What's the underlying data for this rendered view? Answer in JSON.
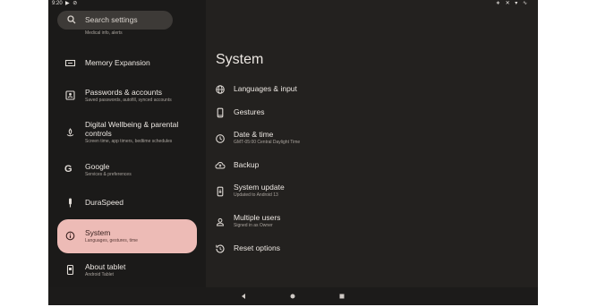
{
  "status_bar": {
    "time": "9:20",
    "left_icons": "▶ ⊘",
    "right_icons": "∗ ✕ ▾ ∿"
  },
  "search": {
    "label": "Search settings"
  },
  "sidebar": {
    "clipped_subtitle": "Medical info, alerts",
    "items": [
      {
        "title": "Memory Expansion",
        "subtitle": "",
        "icon": "memory-icon"
      },
      {
        "title": "Passwords & accounts",
        "subtitle": "Saved passwords, autofill, synced accounts",
        "icon": "account-box-icon"
      },
      {
        "title": "Digital Wellbeing & parental controls",
        "subtitle": "Screen time, app timers, bedtime schedules",
        "icon": "wellbeing-icon"
      },
      {
        "title": "Google",
        "subtitle": "Services & preferences",
        "icon": "google-icon"
      },
      {
        "title": "DuraSpeed",
        "subtitle": "",
        "icon": "duraspeed-icon"
      },
      {
        "title": "System",
        "subtitle": "Languages, gestures, time",
        "icon": "info-icon",
        "selected": true
      },
      {
        "title": "About tablet",
        "subtitle": "Android Tablet",
        "icon": "tablet-icon"
      }
    ]
  },
  "main": {
    "title": "System",
    "items": [
      {
        "title": "Languages & input",
        "subtitle": "",
        "icon": "globe-icon"
      },
      {
        "title": "Gestures",
        "subtitle": "",
        "icon": "phone-icon"
      },
      {
        "title": "Date & time",
        "subtitle": "GMT-05:00 Central Daylight Time",
        "icon": "clock-icon"
      },
      {
        "title": "Backup",
        "subtitle": "",
        "icon": "cloud-upload-icon"
      },
      {
        "title": "System update",
        "subtitle": "Updated to Android 13",
        "icon": "system-update-icon"
      },
      {
        "title": "Multiple users",
        "subtitle": "Signed in as Owner",
        "icon": "person-icon"
      },
      {
        "title": "Reset options",
        "subtitle": "",
        "icon": "history-icon"
      }
    ]
  },
  "colors": {
    "selected_bg": "#edbbb6",
    "sidebar_bg": "#1b1a19",
    "content_bg": "#23211f"
  }
}
